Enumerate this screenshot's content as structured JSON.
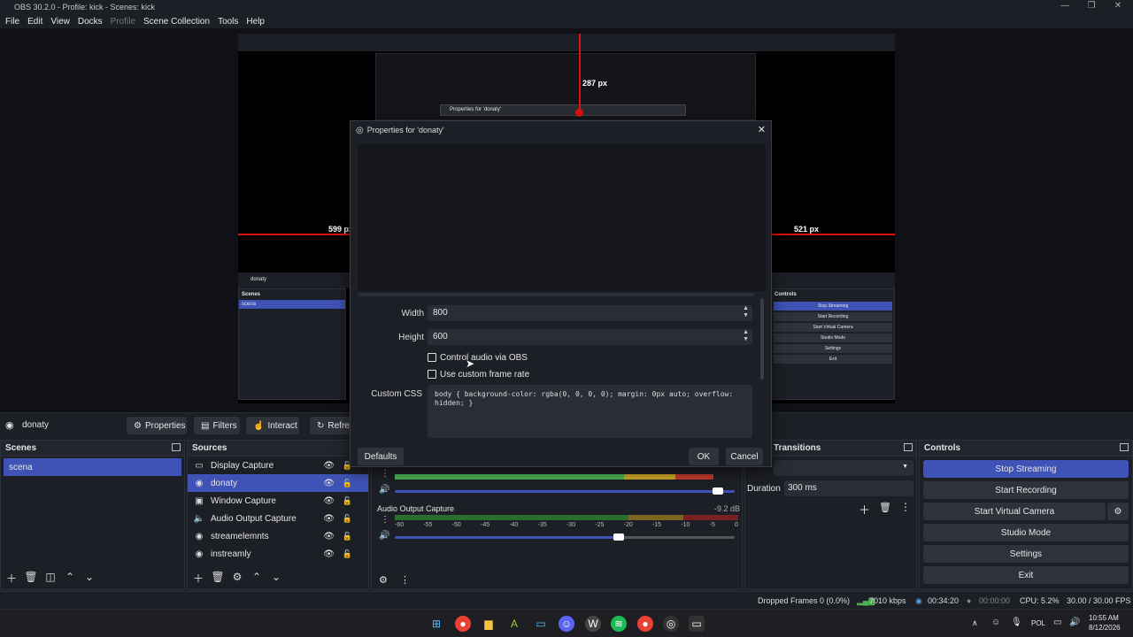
{
  "window": {
    "title": "OBS 30.2.0 - Profile: kick - Scenes: kick",
    "minimize": "—",
    "maximize": "❐",
    "close": "✕"
  },
  "menu": {
    "file": "File",
    "edit": "Edit",
    "view": "View",
    "docks": "Docks",
    "profile": "Profile",
    "scene_collection": "Scene Collection",
    "tools": "Tools",
    "help": "Help"
  },
  "preview": {
    "left_distance": "599 px",
    "right_distance": "521 px",
    "top_distance": "287 px",
    "nested_dialog_title": "Properties for 'donaty'",
    "nested_source_name": "donaty",
    "nested_scenes_head": "Scenes",
    "nested_scene_item": "scena",
    "nested_controls_head": "Controls",
    "nested_controls": [
      "Stop Streaming",
      "Start Recording",
      "Start Virtual Camera",
      "Studio Mode",
      "Settings",
      "Exit"
    ]
  },
  "source_toolbar": {
    "source_name": "donaty",
    "properties": "Properties",
    "filters": "Filters",
    "interact": "Interact",
    "refresh": "Refresh"
  },
  "scenes": {
    "title": "Scenes",
    "items": [
      {
        "label": "scena",
        "selected": true
      }
    ]
  },
  "sources": {
    "title": "Sources",
    "items": [
      {
        "label": "Display Capture",
        "icon": "monitor-icon"
      },
      {
        "label": "donaty",
        "icon": "globe-icon",
        "selected": true
      },
      {
        "label": "Window Capture",
        "icon": "window-icon"
      },
      {
        "label": "Audio Output Capture",
        "icon": "speaker-icon"
      },
      {
        "label": "streamelemnts",
        "icon": "globe-icon"
      },
      {
        "label": "instreamly",
        "icon": "globe-icon"
      }
    ]
  },
  "audio_mixer": {
    "track2_name": "Audio Output Capture",
    "track2_db": "-9.2 dB",
    "scale": [
      "-60",
      "-55",
      "-50",
      "-45",
      "-40",
      "-35",
      "-30",
      "-25",
      "-20",
      "-15",
      "-10",
      "-5",
      "0"
    ],
    "track1_volume_level": 0.95,
    "track2_volume_level": 0.66
  },
  "transitions": {
    "title": "Transitions",
    "duration_label": "Duration",
    "duration_value": "300 ms"
  },
  "controls": {
    "title": "Controls",
    "stop_streaming": "Stop Streaming",
    "start_recording": "Start Recording",
    "start_virtual_camera": "Start Virtual Camera",
    "studio_mode": "Studio Mode",
    "settings": "Settings",
    "exit": "Exit"
  },
  "dialog": {
    "title": "Properties for 'donaty'",
    "width_label": "Width",
    "width_value": "800",
    "height_label": "Height",
    "height_value": "600",
    "control_audio_label": "Control audio via OBS",
    "custom_fps_label": "Use custom frame rate",
    "custom_css_label": "Custom CSS",
    "custom_css_value": "body { background-color: rgba(0, 0, 0, 0); margin: 0px auto; overflow: hidden; }",
    "defaults": "Defaults",
    "ok": "OK",
    "cancel": "Cancel"
  },
  "status": {
    "dropped_frames": "Dropped Frames 0 (0.0%)",
    "bitrate": "7010 kbps",
    "stream_time": "00:34:20",
    "record_time": "00:00:00",
    "cpu": "CPU: 5.2%",
    "fps": "30.00 / 30.00 FPS"
  },
  "taskbar": {
    "lang": "POL",
    "time": "10:55 AM",
    "date": "8/12/2026"
  },
  "colors": {
    "accent": "#3f52b5",
    "guide_red": "#dd1111",
    "meter_green": "#4caf50",
    "meter_yellow": "#c9a227",
    "meter_red": "#c0392b"
  }
}
